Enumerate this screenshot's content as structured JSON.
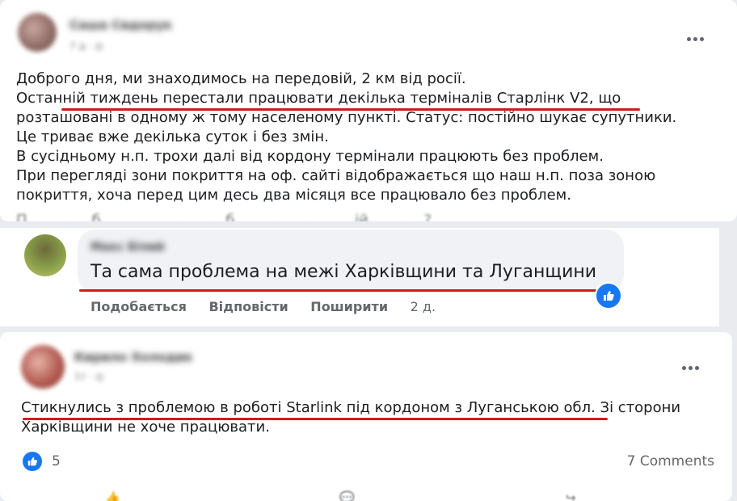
{
  "post1": {
    "author": "Саша Сидорук",
    "meta": "7 д · ◎",
    "lines": [
      "Доброго дня, ми знаходимось на передовій, 2 км від росії.",
      "Останній тиждень перестали працювати декілька терміналів Старлінк V2, що",
      "розташовані в одному ж тому населеному пункті. Статус: постійно шукає супутники.",
      "Це триває вже декілька суток і без змін.",
      "В сусідньому н.п. трохи далі від кордону термінали працюють без проблем.",
      "При перегляді зони покриття на оф. сайті відображається що наш н.п. поза зоною",
      "покриття, хоча перед цим десь два місяця все працювало без проблем."
    ],
    "cut_line": "П..............б...........................б..........................ій............?"
  },
  "comment": {
    "author": "Макс Білий",
    "text": "Та сама проблема на межі Харківщини та Луганщини",
    "actions": {
      "like": "Подобається",
      "reply": "Відповісти",
      "share": "Поширити",
      "time": "2 д."
    }
  },
  "post2": {
    "author": "Кирило Холодик",
    "meta": "1т · ◎",
    "lines": [
      "Стикнулись з проблемою в роботі Starlink під кордоном з Луганською обл. Зі сторони",
      "Харківщини не хоче працювати."
    ],
    "reactions_count": "5",
    "comments_count": "7 Comments"
  },
  "colors": {
    "underline": "#d11b1b",
    "like_blue": "#1877f2",
    "bubble": "#f0f2f5",
    "muted": "#65676b"
  },
  "icons": [
    "more-options-icon",
    "like-reaction-icon"
  ]
}
